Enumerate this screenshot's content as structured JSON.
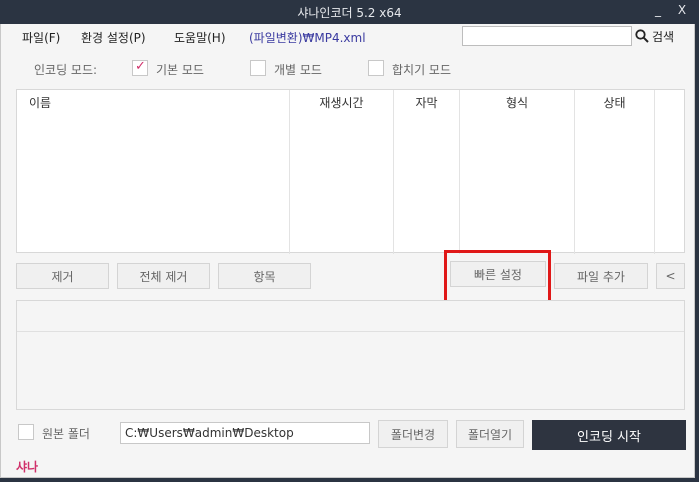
{
  "window": {
    "title": "샤나인코더  5.2 x64",
    "minimize": "_",
    "close": "X"
  },
  "menu": {
    "file": "파일(F)",
    "settings": "환경 설정(P)",
    "help": "도움말(H)",
    "current_path": "(파일변환)₩MP4.xml"
  },
  "search": {
    "value": "",
    "button_label": "검색"
  },
  "encoding_mode": {
    "label": "인코딩 모드:",
    "options": [
      {
        "label": "기본 모드",
        "checked": true
      },
      {
        "label": "개별 모드",
        "checked": false
      },
      {
        "label": "합치기 모드",
        "checked": false
      }
    ]
  },
  "file_list": {
    "columns": [
      "이름",
      "재생시간",
      "자막",
      "형식",
      "상태"
    ]
  },
  "buttons": {
    "remove": "제거",
    "remove_all": "전체 제거",
    "item": "항목",
    "quick_settings": "빠른 설정",
    "add_file": "파일 추가",
    "collapse": "<"
  },
  "output": {
    "source_folder_label": "원본 폴더",
    "source_folder_checked": false,
    "folder_path": "C:₩Users₩admin₩Desktop",
    "change_folder": "폴더변경",
    "open_folder": "폴더열기",
    "start_encoding": "인코딩 시작"
  },
  "status": {
    "brand": "샤나"
  }
}
